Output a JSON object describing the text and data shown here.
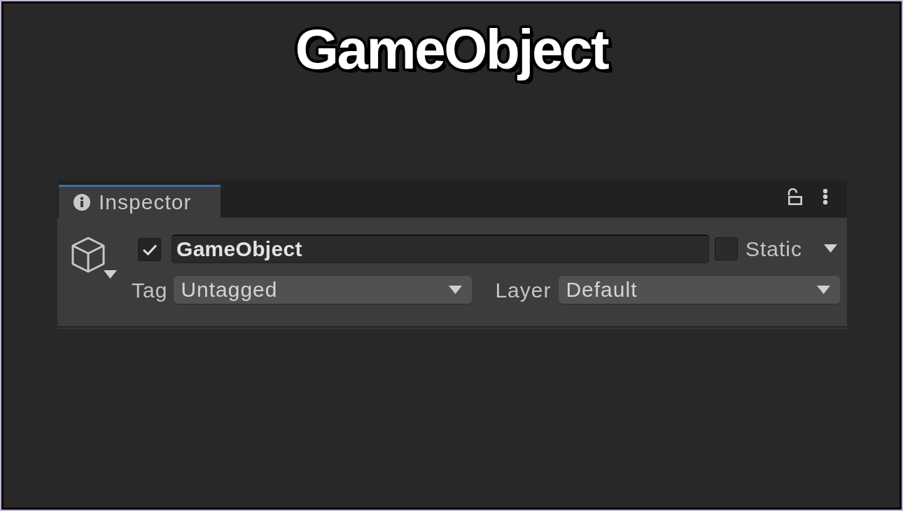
{
  "heading": "GameObject",
  "inspector": {
    "tabs": [
      {
        "label": "Inspector",
        "selected": true
      }
    ],
    "locked": false,
    "object": {
      "active": true,
      "name": "GameObject",
      "static": false,
      "static_label": "Static",
      "fields": [
        {
          "label": "Tag",
          "value": "Untagged"
        },
        {
          "label": "Layer",
          "value": "Default"
        }
      ]
    }
  }
}
